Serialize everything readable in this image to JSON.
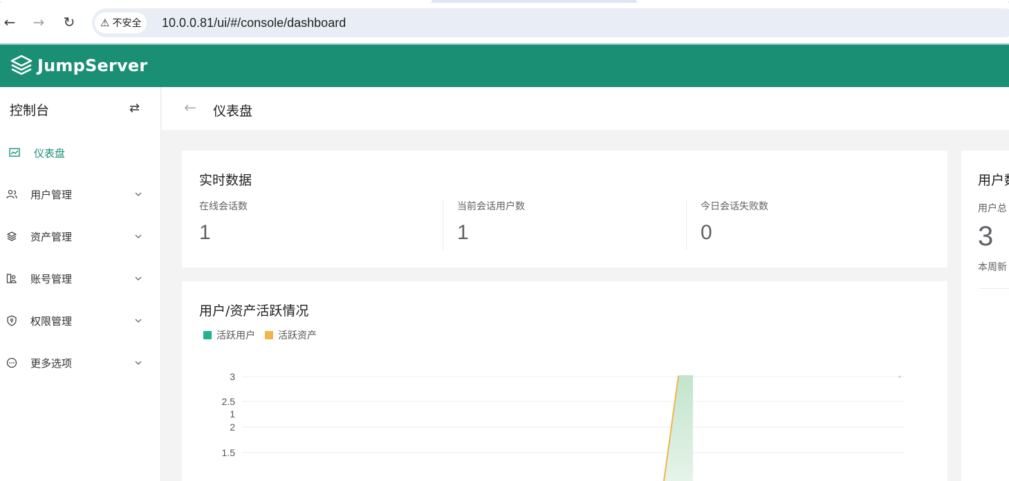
{
  "browser": {
    "back_icon": "←",
    "forward_icon": "→",
    "reload_icon": "↻",
    "security_warning_icon": "⚠",
    "security_label": "不安全",
    "url": "10.0.0.81/ui/#/console/dashboard"
  },
  "header": {
    "logo_text": "JumpServer",
    "brand_color": "#1a8f74"
  },
  "sidebar": {
    "title": "控制台",
    "toggle_icon": "⇄",
    "items": [
      {
        "label": "仪表盘",
        "icon": "dashboard-icon",
        "active": true
      },
      {
        "label": "用户管理",
        "icon": "users-icon",
        "expandable": true
      },
      {
        "label": "资产管理",
        "icon": "layers-icon",
        "expandable": true
      },
      {
        "label": "账号管理",
        "icon": "account-icon",
        "expandable": true
      },
      {
        "label": "权限管理",
        "icon": "shield-icon",
        "expandable": true
      },
      {
        "label": "更多选项",
        "icon": "more-icon",
        "expandable": true
      }
    ]
  },
  "page": {
    "back_icon": "←",
    "title": "仪表盘"
  },
  "realtime": {
    "title": "实时数据",
    "stats": [
      {
        "label": "在线会话数",
        "value": "1"
      },
      {
        "label": "当前会话用户数",
        "value": "1"
      },
      {
        "label": "今日会话失败数",
        "value": "0"
      }
    ]
  },
  "user_card": {
    "title": "用户数",
    "label": "用户总",
    "value": "3",
    "sub_label": "本周新"
  },
  "activity": {
    "title": "用户/资产活跃情况",
    "legend": [
      {
        "name": "活跃用户",
        "color": "#1fb38f"
      },
      {
        "name": "活跃资产",
        "color": "#f0b54d"
      }
    ]
  },
  "chart_data": {
    "type": "line",
    "yaxis_ticks": [
      "3",
      "2.5",
      "1",
      "2",
      "1.5"
    ],
    "ylim": [
      1.5,
      3
    ],
    "series": [
      {
        "name": "活跃用户",
        "color": "#1fb38f",
        "note": "area fill rising to 3"
      },
      {
        "name": "活跃资产",
        "color": "#f0b54d"
      }
    ],
    "grid": true
  }
}
